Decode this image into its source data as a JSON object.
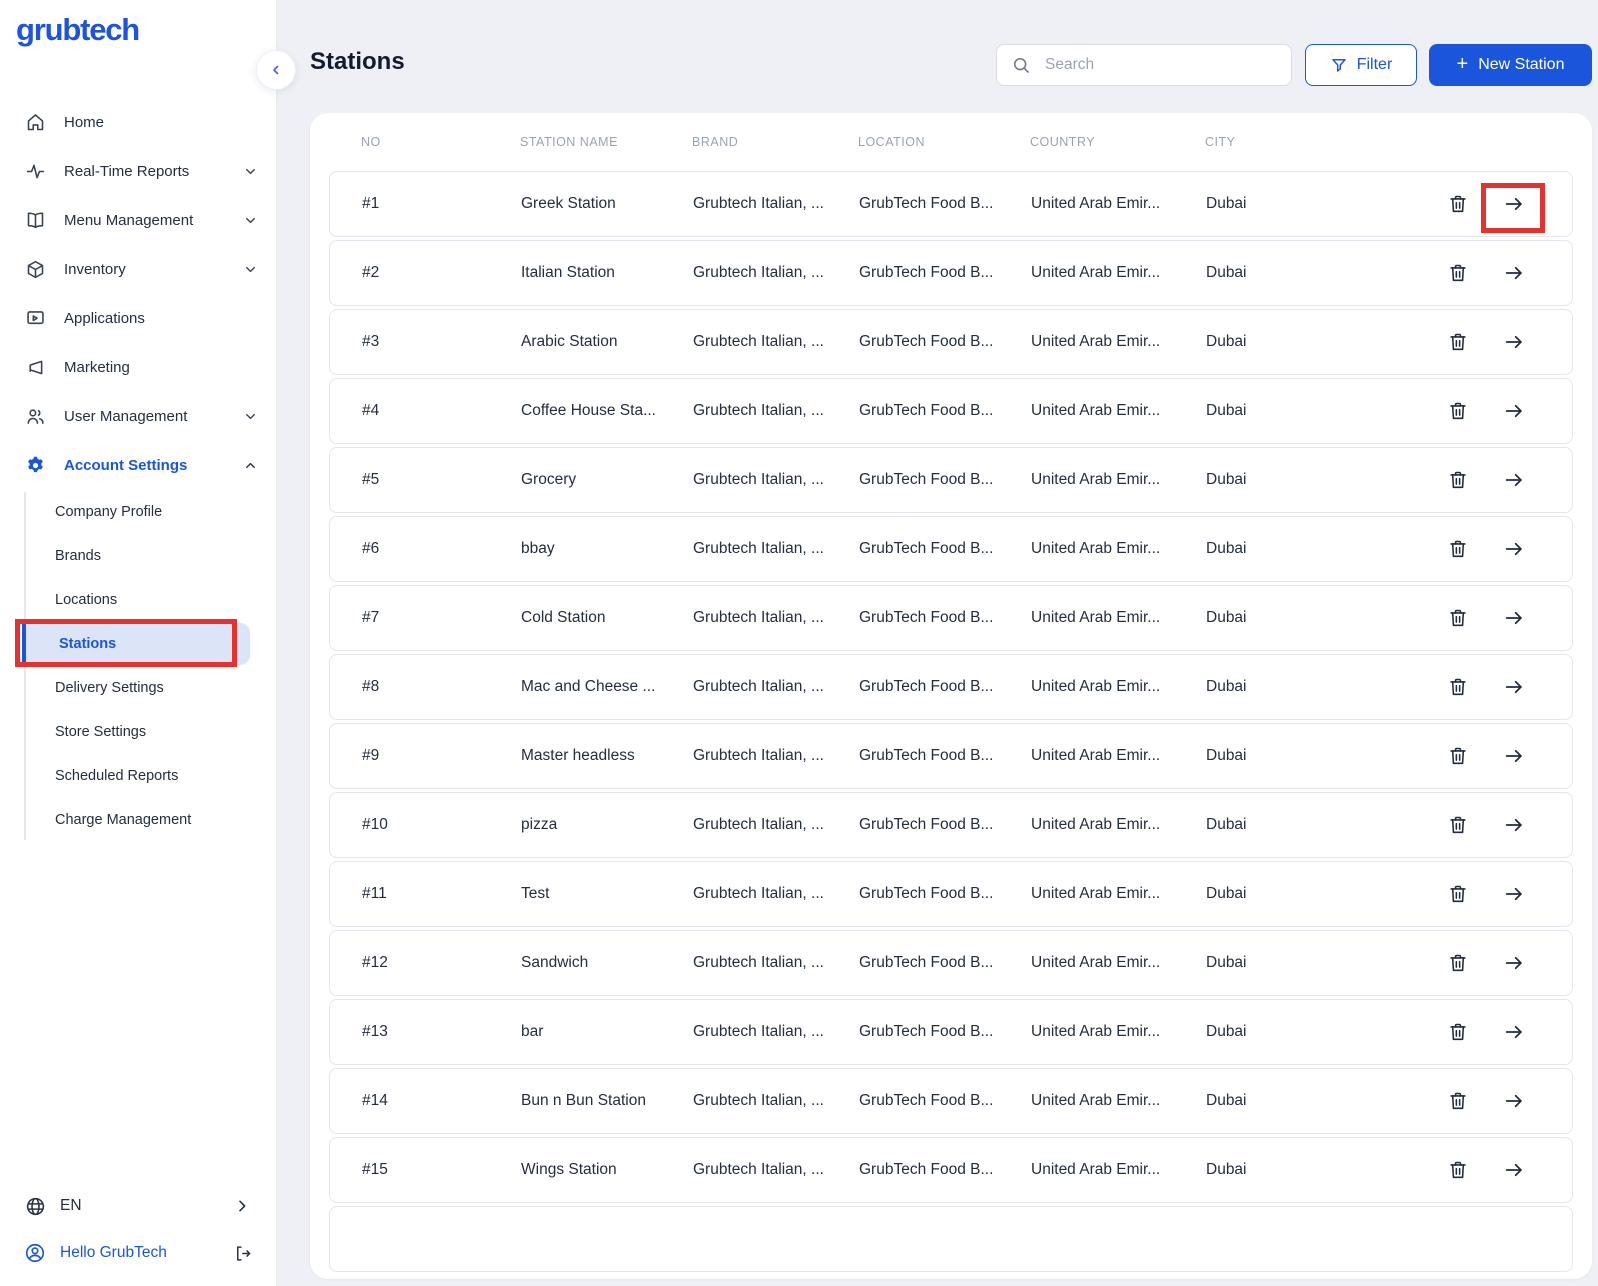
{
  "logo": "grubtech",
  "sidebar": {
    "items": [
      {
        "label": "Home"
      },
      {
        "label": "Real-Time Reports"
      },
      {
        "label": "Menu Management"
      },
      {
        "label": "Inventory"
      },
      {
        "label": "Applications"
      },
      {
        "label": "Marketing"
      },
      {
        "label": "User Management"
      },
      {
        "label": "Account Settings"
      }
    ],
    "submenu": {
      "items": [
        {
          "label": "Company Profile"
        },
        {
          "label": "Brands"
        },
        {
          "label": "Locations"
        },
        {
          "label": "Stations"
        },
        {
          "label": "Delivery Settings"
        },
        {
          "label": "Store Settings"
        },
        {
          "label": "Scheduled Reports"
        },
        {
          "label": "Charge Management"
        }
      ],
      "active_item": "Stations"
    },
    "language": "EN",
    "greeting": "Hello GrubTech"
  },
  "header": {
    "title": "Stations",
    "search_placeholder": "Search",
    "filter_label": "Filter",
    "new_station_label": "New Station"
  },
  "table": {
    "columns": [
      "NO",
      "STATION NAME",
      "BRAND",
      "LOCATION",
      "COUNTRY",
      "CITY"
    ],
    "rows": [
      {
        "no": "#1",
        "name": "Greek Station",
        "brand": "Grubtech Italian, ...",
        "location": "GrubTech Food B...",
        "country": "United Arab Emir...",
        "city": "Dubai"
      },
      {
        "no": "#2",
        "name": "Italian Station",
        "brand": "Grubtech Italian, ...",
        "location": "GrubTech Food B...",
        "country": "United Arab Emir...",
        "city": "Dubai"
      },
      {
        "no": "#3",
        "name": "Arabic Station",
        "brand": "Grubtech Italian, ...",
        "location": "GrubTech Food B...",
        "country": "United Arab Emir...",
        "city": "Dubai"
      },
      {
        "no": "#4",
        "name": "Coffee House Sta...",
        "brand": "Grubtech Italian, ...",
        "location": "GrubTech Food B...",
        "country": "United Arab Emir...",
        "city": "Dubai"
      },
      {
        "no": "#5",
        "name": "Grocery",
        "brand": "Grubtech Italian, ...",
        "location": "GrubTech Food B...",
        "country": "United Arab Emir...",
        "city": "Dubai"
      },
      {
        "no": "#6",
        "name": "bbay",
        "brand": "Grubtech Italian, ...",
        "location": "GrubTech Food B...",
        "country": "United Arab Emir...",
        "city": "Dubai"
      },
      {
        "no": "#7",
        "name": "Cold Station",
        "brand": "Grubtech Italian, ...",
        "location": "GrubTech Food B...",
        "country": "United Arab Emir...",
        "city": "Dubai"
      },
      {
        "no": "#8",
        "name": "Mac and Cheese ...",
        "brand": "Grubtech Italian, ...",
        "location": "GrubTech Food B...",
        "country": "United Arab Emir...",
        "city": "Dubai"
      },
      {
        "no": "#9",
        "name": "Master headless",
        "brand": "Grubtech Italian, ...",
        "location": "GrubTech Food B...",
        "country": "United Arab Emir...",
        "city": "Dubai"
      },
      {
        "no": "#10",
        "name": "pizza",
        "brand": "Grubtech Italian, ...",
        "location": "GrubTech Food B...",
        "country": "United Arab Emir...",
        "city": "Dubai"
      },
      {
        "no": "#11",
        "name": "Test",
        "brand": "Grubtech Italian, ...",
        "location": "GrubTech Food B...",
        "country": "United Arab Emir...",
        "city": "Dubai"
      },
      {
        "no": "#12",
        "name": "Sandwich",
        "brand": "Grubtech Italian, ...",
        "location": "GrubTech Food B...",
        "country": "United Arab Emir...",
        "city": "Dubai"
      },
      {
        "no": "#13",
        "name": "bar",
        "brand": "Grubtech Italian, ...",
        "location": "GrubTech Food B...",
        "country": "United Arab Emir...",
        "city": "Dubai"
      },
      {
        "no": "#14",
        "name": "Bun n Bun Station",
        "brand": "Grubtech Italian, ...",
        "location": "GrubTech Food B...",
        "country": "United Arab Emir...",
        "city": "Dubai"
      },
      {
        "no": "#15",
        "name": "Wings Station",
        "brand": "Grubtech Italian, ...",
        "location": "GrubTech Food B...",
        "country": "United Arab Emir...",
        "city": "Dubai"
      }
    ]
  },
  "colors": {
    "accent": "#1A56DB",
    "logo_blue": "#1D53E0",
    "active_item_bg": "#DCE4F8",
    "annotation_red": "#E8312F",
    "page_bg": "#EEF0F5",
    "row_border": "#E3E6EC",
    "muted_label": "#9AA3B2"
  }
}
